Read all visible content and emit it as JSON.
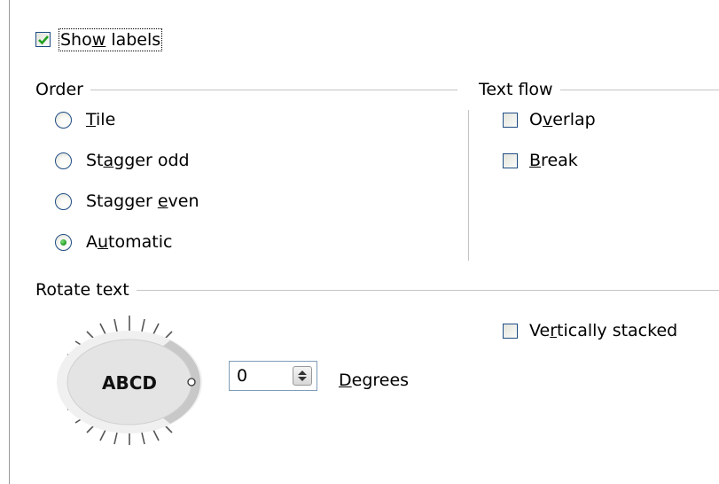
{
  "show_labels": {
    "label": "Show labels",
    "checked": true
  },
  "order": {
    "title": "Order",
    "options": [
      {
        "label": "Tile",
        "checked": false
      },
      {
        "label": "Stagger odd",
        "checked": false
      },
      {
        "label": "Stagger even",
        "checked": false
      },
      {
        "label": "Automatic",
        "checked": true
      }
    ]
  },
  "text_flow": {
    "title": "Text flow",
    "options": [
      {
        "label": "Overlap",
        "checked": false
      },
      {
        "label": "Break",
        "checked": false
      }
    ]
  },
  "rotate_text": {
    "title": "Rotate text",
    "dial_text": "ABCD",
    "degrees_value": "0",
    "degrees_label": "Degrees",
    "vertically_stacked": {
      "label": "Vertically stacked",
      "checked": false
    }
  },
  "colors": {
    "frame_border": "#1f4d84",
    "check_green": "#21a121",
    "dial_fill": "#e4e4e4"
  }
}
